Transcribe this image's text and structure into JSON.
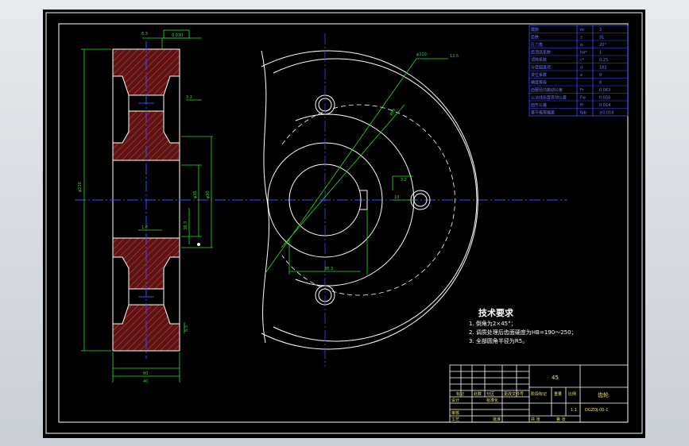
{
  "tech_requirements": {
    "title": "技术要求",
    "items": [
      "1. 倒角为2×45°；",
      "2. 调质处理后齿面硬度为HB=190～250；",
      "3. 全部圆角半径为R5。"
    ]
  },
  "annotations": {
    "roughness_top": "6.3",
    "roughness_hub": "3.2",
    "roughness_bottom_left": "1.6",
    "roughness_bottom": "6.3",
    "other_roughness": "12.5",
    "keyway_roughness": "3.2",
    "dim_phi_hub": "φ22",
    "dim_phi_bore": "φ35",
    "dim_phi_circle": "φ90",
    "dim_width": "40",
    "dim_hub_width": "60",
    "dim_key_depth": "38.3",
    "dim_key_width": "10",
    "dim_dia_label": "φ210",
    "tolerance_box": "0.030"
  },
  "param_table": {
    "rows": [
      [
        "模数",
        "m",
        "2"
      ],
      [
        "齿数",
        "z",
        "91"
      ],
      [
        "压力角",
        "α",
        "20°"
      ],
      [
        "齿顶高系数",
        "ha*",
        "1"
      ],
      [
        "顶隙系数",
        "c*",
        "0.25"
      ],
      [
        "分度圆直径",
        "d",
        "182"
      ],
      [
        "变位系数",
        "x",
        "0"
      ],
      [
        "精度等级",
        "",
        "8"
      ],
      [
        "齿圈径向跳动公差",
        "Fr",
        "0.063"
      ],
      [
        "公法线长度变动公差",
        "Fw",
        "0.050"
      ],
      [
        "齿形公差",
        "ff",
        "0.014"
      ],
      [
        "基节极限偏差",
        "fpb",
        "±0.016"
      ]
    ]
  },
  "title_block": {
    "part_name": "齿轮",
    "material": "45",
    "drawing_no": "DGZDJ-00-1",
    "scale": "1:1",
    "labels": [
      "标记",
      "处数",
      "分区",
      "更改文件号",
      "签名",
      "年月日",
      "设计",
      "标准化",
      "阶段标记",
      "重量",
      "比例",
      "审核",
      "工艺",
      "批准",
      "共 张",
      "第 张"
    ]
  },
  "colors": {
    "outline": "#ffffff",
    "centerline": "#3d4bff",
    "dimension": "#24e024",
    "hatch": "#c23b3b",
    "hatch_fill": "#5a1414",
    "text": "#f5e26a",
    "background": "#000000"
  }
}
